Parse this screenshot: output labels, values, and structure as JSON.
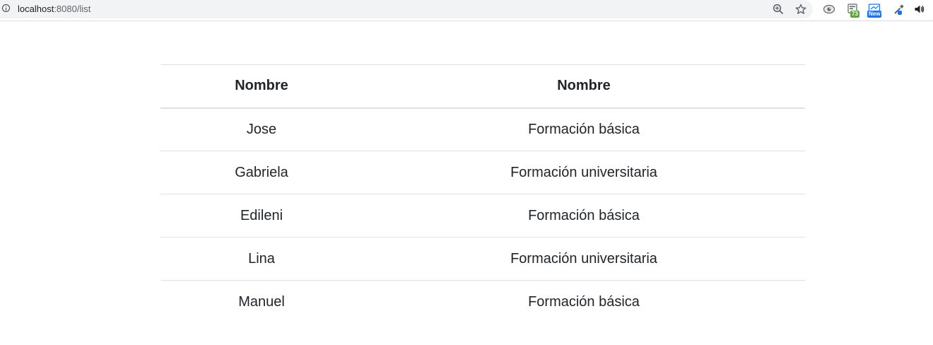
{
  "browser": {
    "url_host": "localhost",
    "url_rest": ":8080/list",
    "extensions": [
      {
        "icon": "extension-icon",
        "badge": ""
      },
      {
        "icon": "extension-icon",
        "badge": "73"
      },
      {
        "icon": "extension-icon",
        "badge": "New"
      },
      {
        "icon": "eyedropper-icon",
        "badge": ""
      }
    ]
  },
  "table": {
    "headers": [
      "Nombre",
      "Nombre"
    ],
    "rows": [
      [
        "Jose",
        "Formación básica"
      ],
      [
        "Gabriela",
        "Formación universitaria"
      ],
      [
        "Edileni",
        "Formación básica"
      ],
      [
        "Lina",
        "Formación universitaria"
      ],
      [
        "Manuel",
        "Formación básica"
      ]
    ]
  }
}
